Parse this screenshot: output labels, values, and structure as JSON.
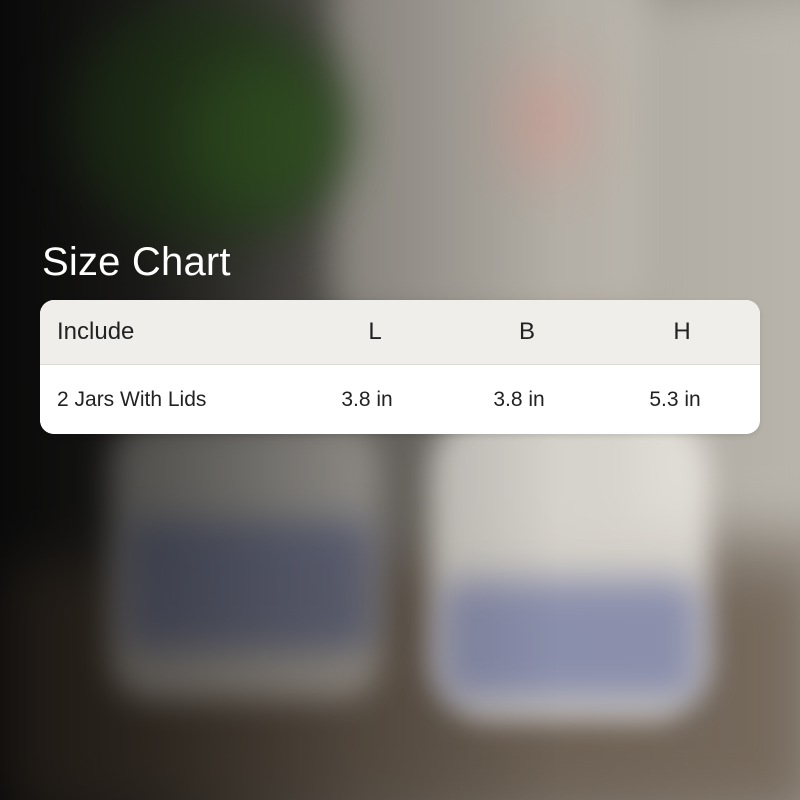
{
  "title": "Size Chart",
  "table": {
    "headers": [
      "Include",
      "L",
      "B",
      "H"
    ],
    "rows": [
      [
        "2 Jars With Lids",
        "3.8 in",
        "3.8 in",
        "5.3 in"
      ]
    ]
  }
}
